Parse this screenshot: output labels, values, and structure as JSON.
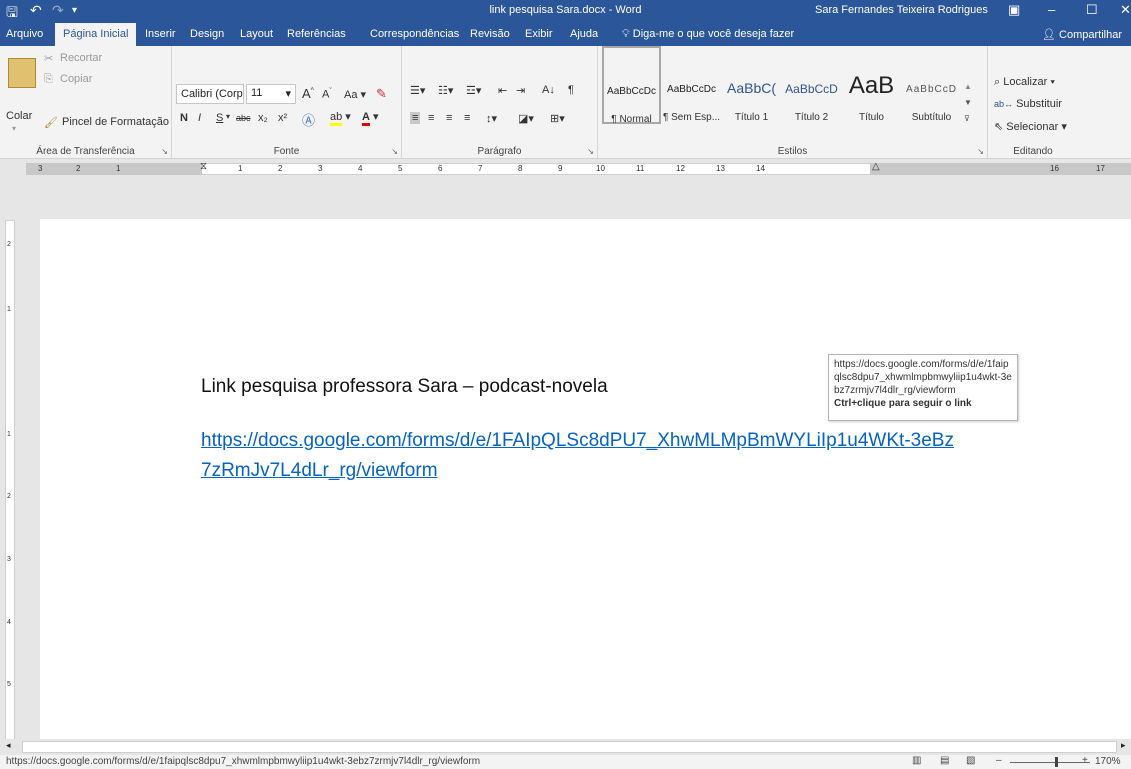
{
  "window": {
    "title": "link pesquisa Sara.docx  -  Word",
    "user": "Sara Fernandes Teixeira Rodrigues"
  },
  "tabs": [
    "Arquivo",
    "Página Inicial",
    "Inserir",
    "Design",
    "Layout",
    "Referências",
    "Correspondências",
    "Revisão",
    "Exibir",
    "Ajuda"
  ],
  "tell_me": "Diga-me o que você deseja fazer",
  "share": "Compartilhar",
  "clipboard": {
    "paste": "Colar",
    "cut": "Recortar",
    "copy": "Copiar",
    "format_painter": "Pincel de Formatação",
    "label": "Área de Transferência"
  },
  "font": {
    "name": "Calibri (Corp",
    "size": "11",
    "bold": "N",
    "italic": "I",
    "underline": "S",
    "strike": "abc",
    "sub": "x₂",
    "sup": "x²",
    "case": "Aa",
    "grow": "A",
    "shrink": "A",
    "label": "Fonte"
  },
  "paragraph": {
    "label": "Parágrafo",
    "sort": "A↓",
    "pilcrow": "¶"
  },
  "styles": {
    "label": "Estilos",
    "items": [
      {
        "preview": "AaBbCcDc",
        "name": "¶ Normal"
      },
      {
        "preview": "AaBbCcDc",
        "name": "¶ Sem Esp..."
      },
      {
        "preview": "AaBbC(",
        "name": "Título 1"
      },
      {
        "preview": "AaBbCcD",
        "name": "Título 2"
      },
      {
        "preview": "AaB",
        "name": "Título"
      },
      {
        "preview": "AaBbCcD",
        "name": "Subtítulo"
      }
    ]
  },
  "editing": {
    "find": "Localizar",
    "replace": "Substituir",
    "select": "Selecionar",
    "label": "Editando"
  },
  "ruler": {
    "h_numbers": [
      "3",
      "2",
      "1",
      "1",
      "2",
      "3",
      "4",
      "5",
      "6",
      "7",
      "8",
      "9",
      "10",
      "11",
      "12",
      "13",
      "14",
      "16",
      "17"
    ],
    "v_numbers": [
      "2",
      "1",
      "1",
      "2",
      "3",
      "4",
      "5"
    ],
    "tab_selector": "L"
  },
  "document": {
    "heading": "Link pesquisa professora Sara – podcast-novela",
    "link": "https://docs.google.com/forms/d/e/1FAIpQLSc8dPU7_XhwMLMpBmWYLiIp1u4WKt-3eBz7zRmJv7L4dLr_rg/viewform"
  },
  "tooltip": {
    "url": "https://docs.google.com/forms/d/e/1faipqlsc8dpu7_xhwmlmpbmwyliip1u4wkt-3ebz7zrmjv7l4dlr_rg/viewform",
    "hint": "Ctrl+clique para seguir o link"
  },
  "status": {
    "url": "https://docs.google.com/forms/d/e/1faipqlsc8dpu7_xhwmlmpbmwyliip1u4wkt-3ebz7zrmjv7l4dlr_rg/viewform",
    "zoom": "170%"
  },
  "colors": {
    "accent": "#2b579a",
    "link": "#0563c1"
  }
}
